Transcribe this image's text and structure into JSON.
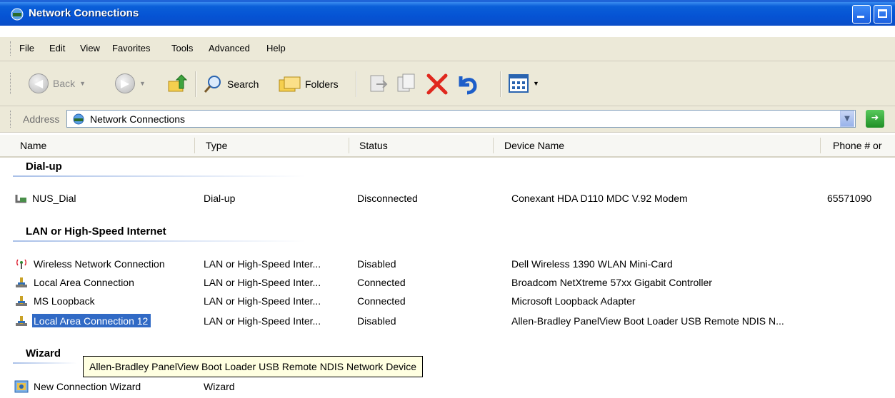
{
  "window": {
    "title": "Network Connections"
  },
  "menu": {
    "items": [
      "File",
      "Edit",
      "View",
      "Favorites",
      "Tools",
      "Advanced",
      "Help"
    ]
  },
  "toolbar": {
    "back": "Back",
    "search": "Search",
    "folders": "Folders"
  },
  "address": {
    "label": "Address",
    "value": "Network Connections"
  },
  "columns": [
    "Name",
    "Type",
    "Status",
    "Device Name",
    "Phone # or"
  ],
  "groups": [
    {
      "title": "Dial-up",
      "rows": [
        {
          "name": "NUS_Dial",
          "type": "Dial-up",
          "status": "Disconnected",
          "device": "Conexant HDA D110 MDC V.92 Modem",
          "phone": "65571090",
          "icon": "dialup-icon"
        }
      ]
    },
    {
      "title": "LAN or High-Speed Internet",
      "rows": [
        {
          "name": "Wireless Network Connection",
          "type": "LAN or High-Speed Inter...",
          "status": "Disabled",
          "device": "Dell Wireless 1390 WLAN Mini-Card",
          "phone": "",
          "icon": "wireless-icon"
        },
        {
          "name": "Local Area Connection",
          "type": "LAN or High-Speed Inter...",
          "status": "Connected",
          "device": "Broadcom NetXtreme 57xx Gigabit Controller",
          "phone": "",
          "icon": "lan-icon"
        },
        {
          "name": "MS Loopback",
          "type": "LAN or High-Speed Inter...",
          "status": "Connected",
          "device": "Microsoft Loopback Adapter",
          "phone": "",
          "icon": "lan-icon"
        },
        {
          "name": "Local Area Connection 12",
          "type": "LAN or High-Speed Inter...",
          "status": "Disabled",
          "device": "Allen-Bradley PanelView Boot Loader USB Remote NDIS N...",
          "phone": "",
          "icon": "lan-icon",
          "selected": true
        }
      ]
    },
    {
      "title": "Wizard",
      "rows": [
        {
          "name": "New Connection Wizard",
          "type": "Wizard",
          "status": "",
          "device": "",
          "phone": "",
          "icon": "wizard-icon"
        }
      ]
    }
  ],
  "tooltip": "Allen-Bradley PanelView Boot Loader USB Remote NDIS Network Device"
}
